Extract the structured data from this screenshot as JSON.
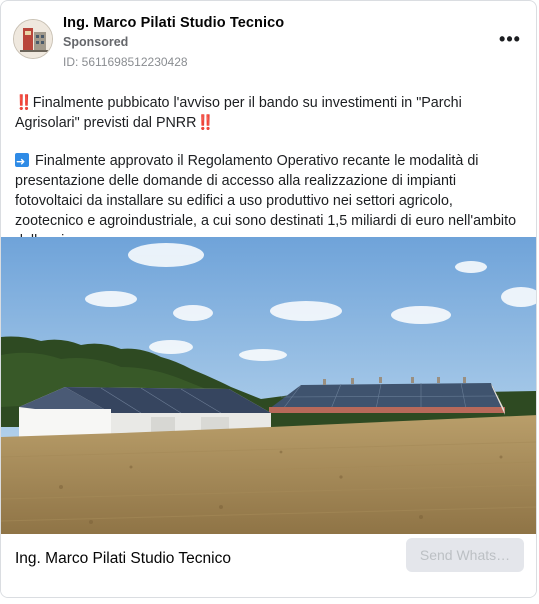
{
  "ad": {
    "page_name": "Ing. Marco Pilati Studio Tecnico",
    "sponsored": "Sponsored",
    "ad_id": "ID: 561169851223042​8",
    "more_label": "•••",
    "paragraph1": "‼️Finalmente pubbicato l'avviso per il bando su investimenti in \"Parchi Agrisolari\" previsti dal PNRR‼️",
    "paragraph2": "Finalmente approvato il Regolamento Operativo recante le modalità di presentazione delle domande di accesso alla realizzazione di impianti fotovoltaici da installare su edifici a uso produttivo nei settori agricolo, zootecnico e agroindustriale, a cui sono destinati 1,5 miliardi di euro nell'ambito della misura…",
    "image_icon": "farm-buildings-with-solar-panels-photo",
    "footer_name": "Ing. Marco Pilati Studio Tecnico",
    "cta_label": "Send Whats…"
  },
  "colors": {
    "muted_text": "#65676b",
    "cta_bg": "#e4e6eb",
    "cta_text": "#bcc0c4",
    "emoji_blue": "#2f8be6"
  }
}
